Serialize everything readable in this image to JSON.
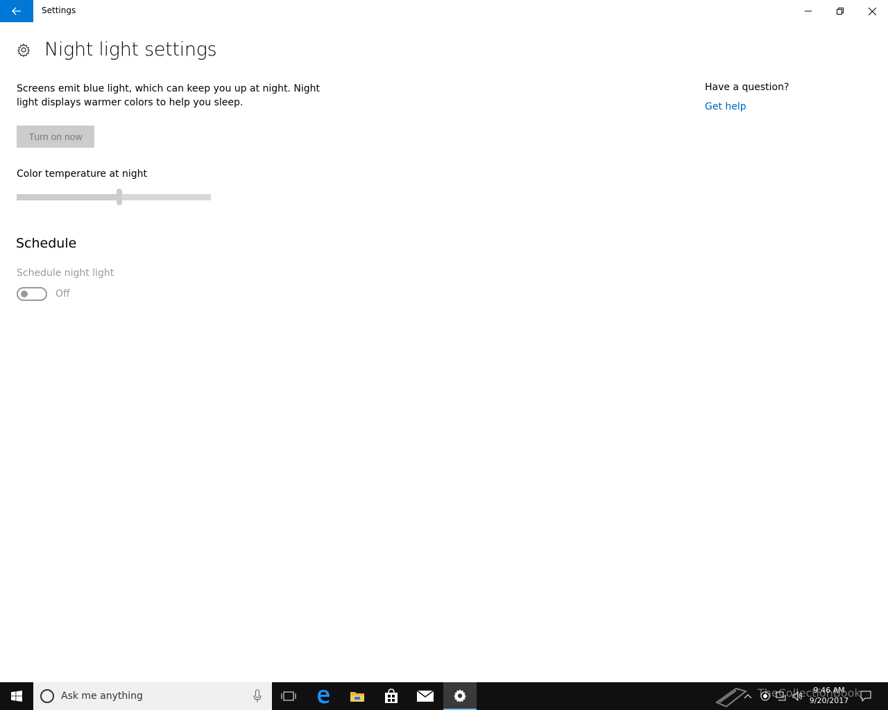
{
  "window": {
    "title": "Settings",
    "back_icon": "back-arrow-icon",
    "controls": {
      "minimize_icon": "minimize-icon",
      "restore_icon": "restore-icon",
      "close_icon": "close-icon"
    }
  },
  "page": {
    "icon": "gear-icon",
    "title": "Night light settings",
    "description": "Screens emit blue light, which can keep you up at night. Night light displays warmer colors to help you sleep.",
    "turn_on_button": "Turn on now",
    "color_temp_label": "Color temperature at night",
    "color_temp_slider_value": 0.53,
    "schedule_heading": "Schedule",
    "schedule_label": "Schedule night light",
    "schedule_toggle_state": "Off"
  },
  "help": {
    "heading": "Have a question?",
    "link": "Get help"
  },
  "taskbar": {
    "search_placeholder": "Ask me anything",
    "pinned": [
      "start-icon",
      "task-view-icon",
      "edge-icon",
      "file-explorer-icon",
      "store-icon",
      "mail-icon",
      "settings-icon"
    ],
    "active_app": "settings-icon",
    "time": "9:46 AM",
    "date": "9/20/2017",
    "watermark": "TheCollectionBook"
  },
  "colors": {
    "accent": "#0078d7",
    "link": "#0063b1",
    "taskbar": "#101010",
    "disabled_text": "#999999"
  }
}
